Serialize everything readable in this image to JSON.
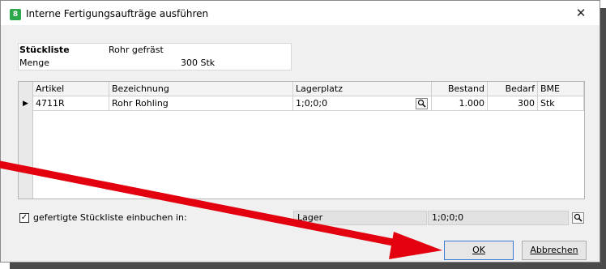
{
  "window": {
    "title": "Interne Fertigungsaufträge ausführen",
    "close_glyph": "✕",
    "app_icon_glyph": "8"
  },
  "header": {
    "stueckliste_label": "Stückliste",
    "stueckliste_value": "Rohr gefräst",
    "menge_label": "Menge",
    "menge_value": "300 Stk"
  },
  "table": {
    "columns": [
      "Artikel",
      "Bezeichnung",
      "Lagerplatz",
      "Bestand",
      "Bedarf",
      "BME"
    ],
    "rows": [
      {
        "artikel": "4711R",
        "bezeichnung": "Rohr Rohling",
        "lagerplatz": "1;0;0;0",
        "bestand": "1.000",
        "bedarf": "300",
        "bme": "Stk"
      }
    ]
  },
  "footer": {
    "checkbox_checked": true,
    "checkbox_label": "gefertigte Stückliste einbuchen in:",
    "lager_label": "Lager",
    "lager_value": "1;0;0;0"
  },
  "buttons": {
    "ok": "OK",
    "cancel": "Abbrechen"
  },
  "annotation_color": "#e3000f"
}
